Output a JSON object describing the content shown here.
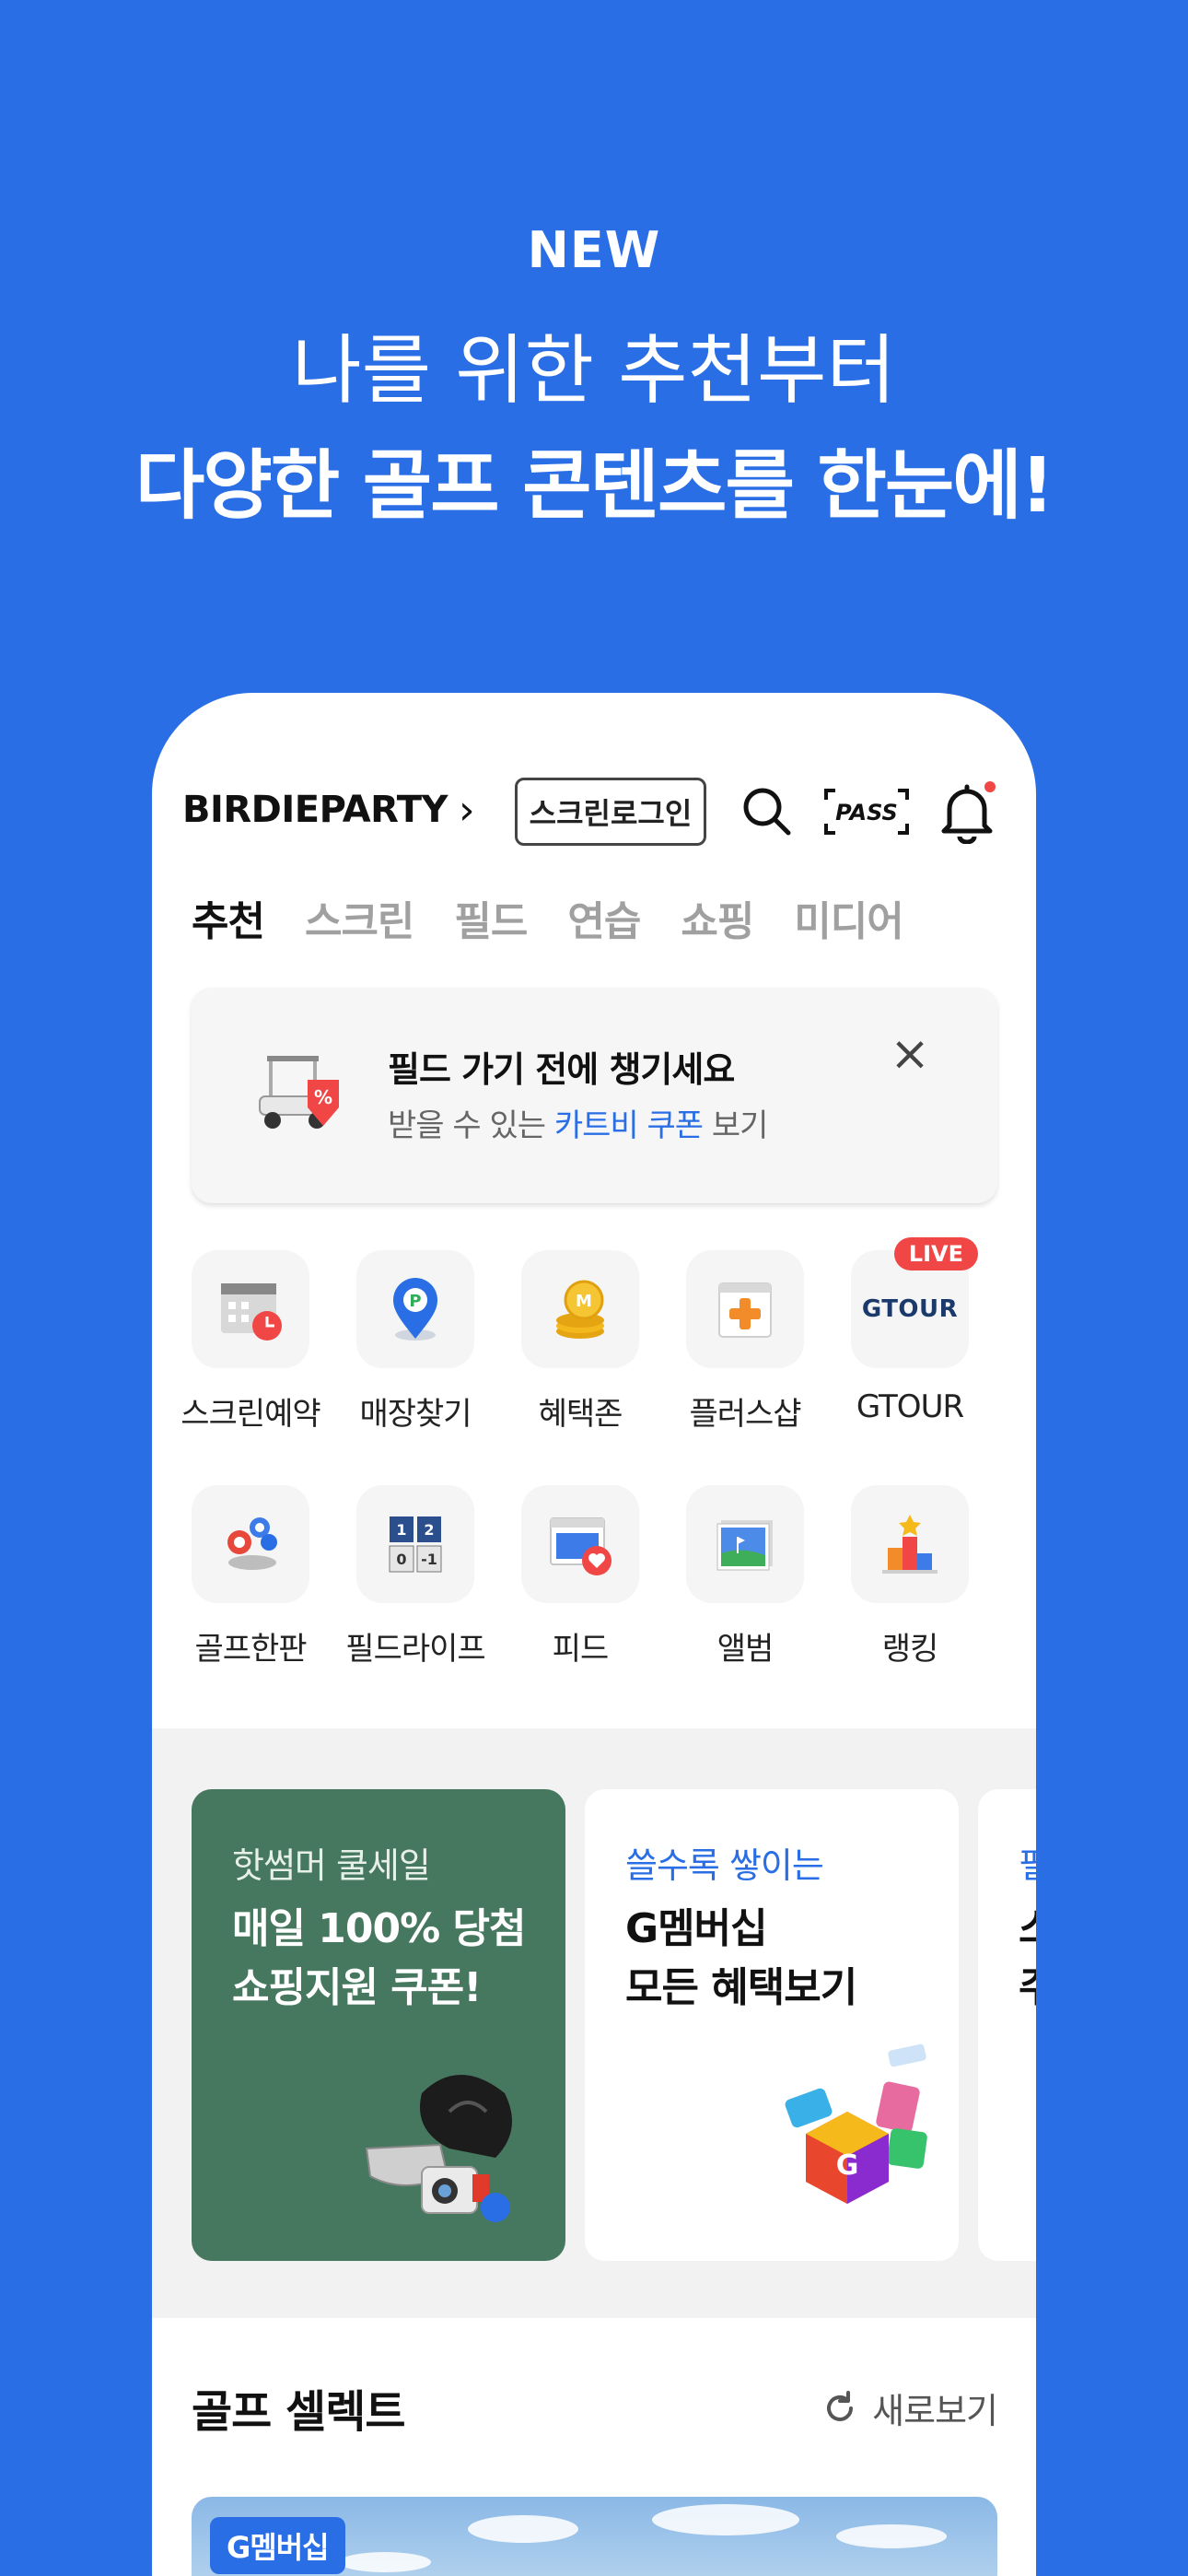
{
  "promo": {
    "badge": "NEW",
    "line1": "나를 위한 추천부터",
    "line2": "다양한 골프 콘텐츠를 한눈에!"
  },
  "header": {
    "brand": "BIRDIEPARTY",
    "screen_login": "스크린로그인",
    "pass_label": "PASS"
  },
  "tabs": [
    "추천",
    "스크린",
    "필드",
    "연습",
    "쇼핑",
    "미디어"
  ],
  "notice": {
    "title": "필드 가기 전에 챙기세요",
    "sub_prefix": "받을 수 있는",
    "sub_highlight": "카트비 쿠폰",
    "sub_suffix": "보기"
  },
  "menu": {
    "row1": [
      "스크린예약",
      "매장찾기",
      "혜택존",
      "플러스샵",
      "GTOUR"
    ],
    "row2": [
      "골프한판",
      "필드라이프",
      "피드",
      "앨범",
      "랭킹"
    ],
    "live_badge": "LIVE",
    "gtour_logo": "GTOUR",
    "scoreboard": [
      "1",
      "2",
      "0",
      "-1"
    ]
  },
  "cards": [
    {
      "kicker": "핫썸머 쿨세일",
      "title1": "매일 100% 당첨",
      "title2": "쇼핑지원 쿠폰!"
    },
    {
      "kicker": "쓸수록 쌓이는",
      "title1": "G멤버십",
      "title2": "모든 혜택보기"
    },
    {
      "kicker": "필",
      "title1": "스",
      "title2": "주"
    }
  ],
  "select": {
    "title": "골프 셀렉트",
    "refresh": "새로보기",
    "badge": "G멤버십"
  },
  "colors": {
    "brand_blue": "#2a6ee6",
    "card_green": "#46775f",
    "live_red": "#f04646"
  }
}
